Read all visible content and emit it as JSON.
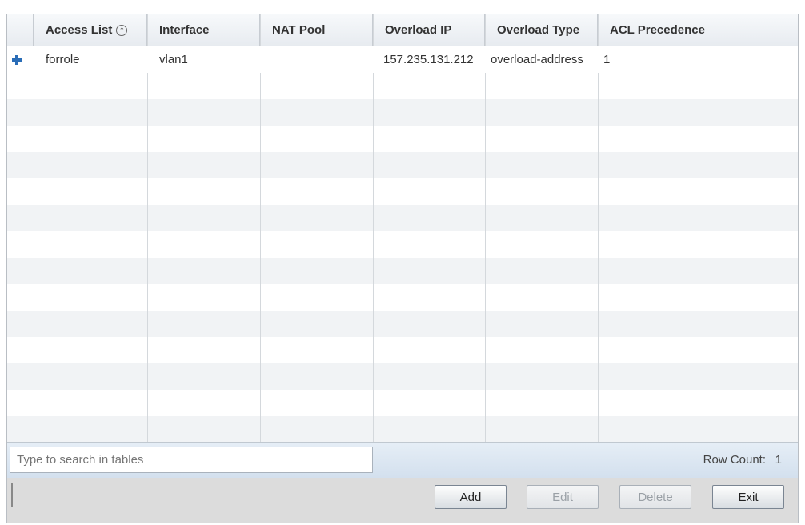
{
  "table": {
    "columns": [
      {
        "label": "Access List"
      },
      {
        "label": "Interface"
      },
      {
        "label": "NAT Pool"
      },
      {
        "label": "Overload IP"
      },
      {
        "label": "Overload Type"
      },
      {
        "label": "ACL Precedence"
      }
    ],
    "rows": [
      {
        "access_list": "forrole",
        "interface": "vlan1",
        "nat_pool": "",
        "overload_ip": "157.235.131.212",
        "overload_type": "overload-address",
        "acl_precedence": "1"
      }
    ]
  },
  "search": {
    "placeholder": "Type to search in tables"
  },
  "row_count": {
    "label": "Row Count:",
    "value": "1"
  },
  "buttons": {
    "add": "Add",
    "edit": "Edit",
    "delete": "Delete",
    "exit": "Exit"
  },
  "icons": {
    "expand_row": "plus-icon",
    "sort": "sort-ascending-icon"
  },
  "colors": {
    "header_bg": "#e7ebf0",
    "footer_bg": "#d3e0ee",
    "accent": "#2a6db7"
  }
}
